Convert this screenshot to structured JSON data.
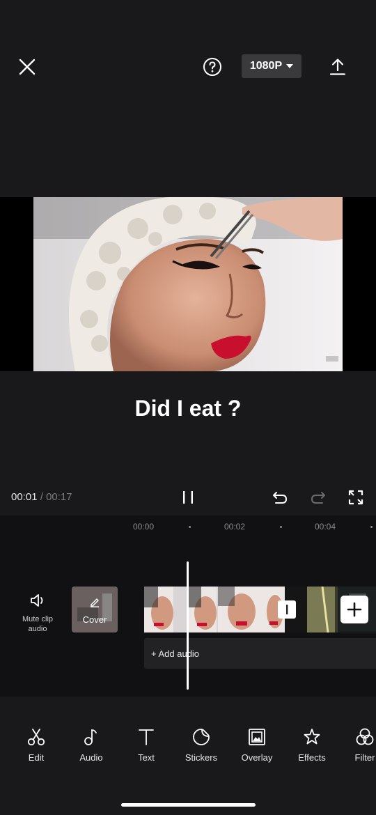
{
  "header": {
    "resolution_label": "1080P",
    "icons": [
      "close-icon",
      "help-icon",
      "export-icon"
    ]
  },
  "preview": {
    "caption": "Did I eat ?"
  },
  "playback": {
    "current_time": "00:01",
    "separator": "/",
    "total_time": "00:17"
  },
  "timeline": {
    "ruler_labels": [
      "00:00",
      "00:02",
      "00:04"
    ],
    "mute_label": "Mute clip\naudio",
    "mute_line1": "Mute clip",
    "mute_line2": "audio",
    "cover_label": "Cover",
    "add_audio_label": "+ Add audio"
  },
  "toolbar": {
    "items": [
      {
        "label": "Edit",
        "icon": "scissors-icon"
      },
      {
        "label": "Audio",
        "icon": "music-note-icon"
      },
      {
        "label": "Text",
        "icon": "text-icon"
      },
      {
        "label": "Stickers",
        "icon": "sticker-icon"
      },
      {
        "label": "Overlay",
        "icon": "overlay-icon"
      },
      {
        "label": "Effects",
        "icon": "effects-star-icon"
      },
      {
        "label": "Filter",
        "icon": "filter-icon"
      }
    ]
  },
  "colors": {
    "background": "#19191b",
    "timeline_bg": "#111113",
    "lip_red": "#c8102e"
  }
}
